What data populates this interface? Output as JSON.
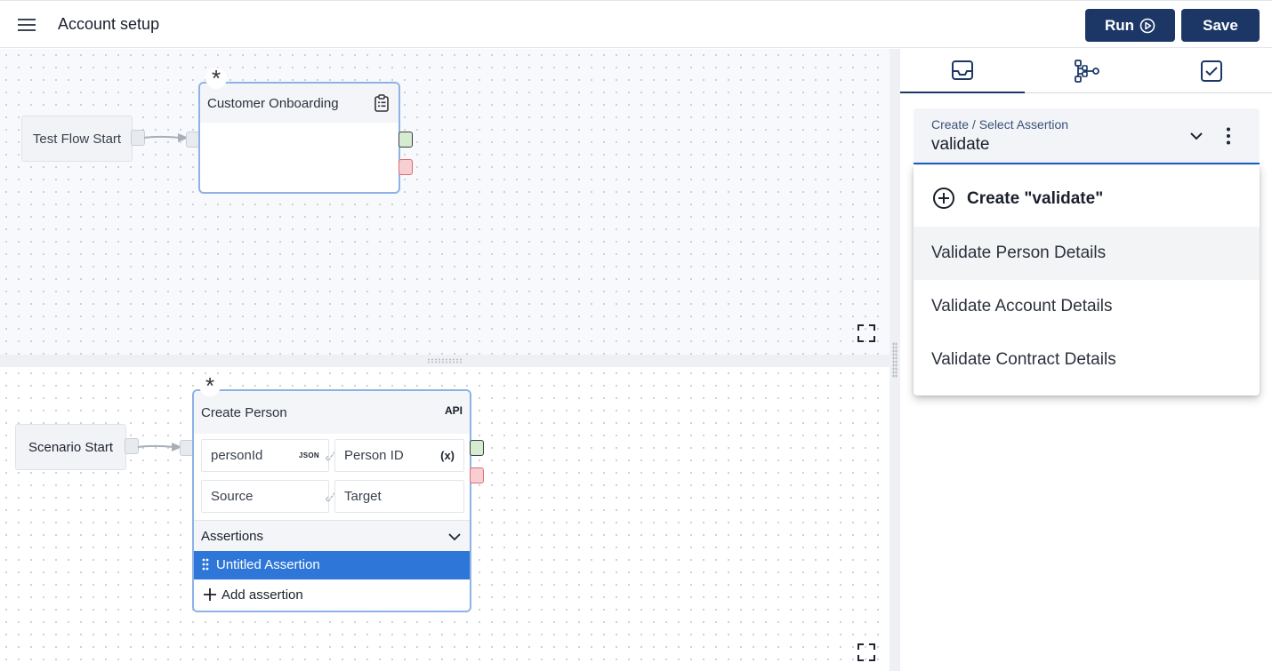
{
  "header": {
    "title": "Account setup",
    "run_label": "Run",
    "save_label": "Save"
  },
  "top_canvas": {
    "start_node": "Test Flow Start",
    "flow_node": {
      "title": "Customer Onboarding"
    }
  },
  "bottom_canvas": {
    "start_node": "Scenario Start",
    "api_node": {
      "title": "Create Person",
      "badge": "API",
      "mappings": [
        {
          "source": "personId",
          "source_tag": "JSON",
          "target": "Person ID",
          "target_tag": "(x)"
        },
        {
          "source": "Source",
          "target": "Target"
        }
      ],
      "assertions_header": "Assertions",
      "selected_assertion": "Untitled Assertion",
      "add_assertion_label": "Add assertion"
    }
  },
  "right_panel": {
    "tabs": [
      {
        "icon": "inbox-icon",
        "active": true
      },
      {
        "icon": "flow-tree-icon",
        "active": false
      },
      {
        "icon": "checkbox-icon",
        "active": false
      }
    ],
    "combo": {
      "label": "Create / Select Assertion",
      "value": "validate"
    },
    "dropdown": {
      "create_label": "Create \"validate\"",
      "options": [
        "Validate Person Details",
        "Validate Account Details",
        "Validate Contract Details"
      ]
    }
  },
  "colors": {
    "primary": "#1c3766",
    "node_border": "#8db2e6",
    "selected_row": "#2e77d8",
    "success_port": "#d5ecd0",
    "error_port": "#f7cfd2"
  }
}
